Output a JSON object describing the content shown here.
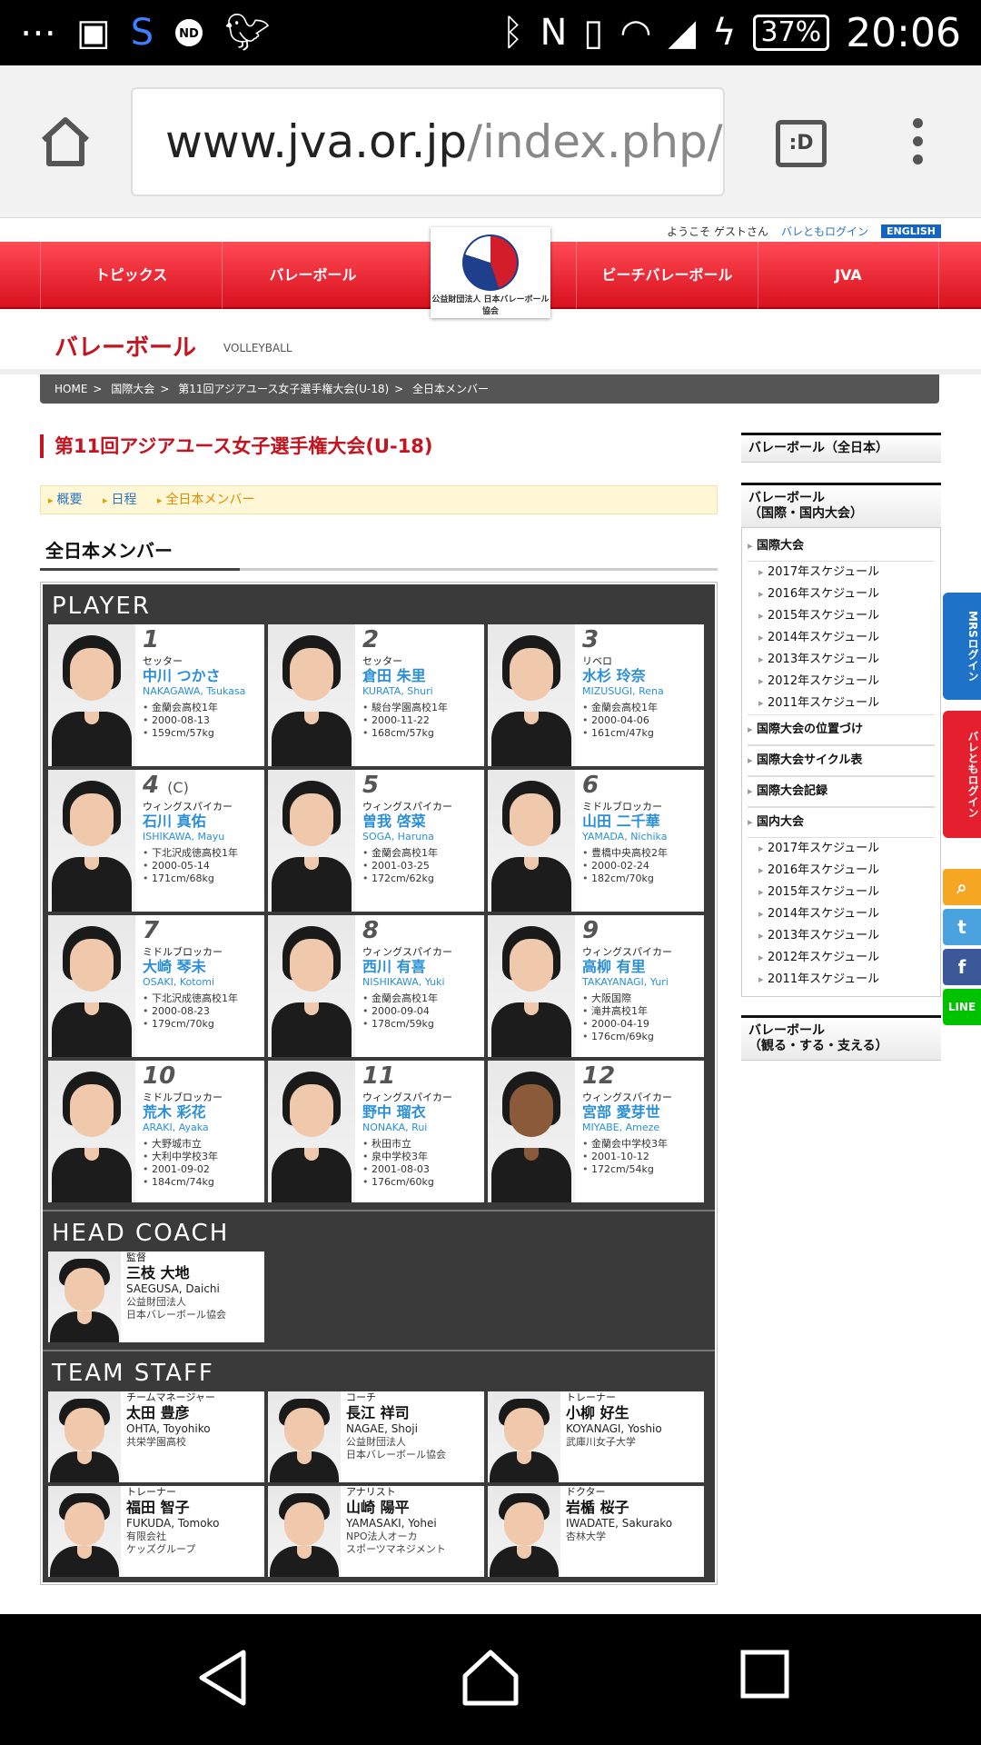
{
  "status": {
    "battery": "37%",
    "time": "20:06",
    "notif_badge": "ND"
  },
  "browser": {
    "url_host": "www.jva.or.jp",
    "url_path": "/index.php/",
    "tab_label": ":D"
  },
  "site": {
    "welcome": "ようこそ ゲストさん",
    "login_link": "バレともログイン",
    "english": "ENGLISH",
    "nav": [
      "トピックス",
      "バレーボール",
      "ビーチバレーボール",
      "JVA"
    ],
    "logo_text": "公益財団法人 日本バレーボール協会",
    "section_title": "バレーボール",
    "section_sub": "VOLLEYBALL"
  },
  "breadcrumb": [
    "HOME",
    "国際大会",
    "第11回アジアユース女子選手権大会(U-18)",
    "全日本メンバー"
  ],
  "event_title": "第11回アジアユース女子選手権大会(U-18)",
  "subnav": {
    "items": [
      "概要",
      "日程",
      "全日本メンバー"
    ]
  },
  "members_heading": "全日本メンバー",
  "groups": {
    "player": "PLAYER",
    "coach": "HEAD COACH",
    "staff": "TEAM STAFF"
  },
  "players": [
    {
      "num": "1",
      "cap": "",
      "pos": "セッター",
      "jp": "中川 つかさ",
      "en": "NAKAGAWA, Tsukasa",
      "details": [
        "金蘭会高校1年",
        "2000-08-13",
        "159cm/57kg"
      ]
    },
    {
      "num": "2",
      "cap": "",
      "pos": "セッター",
      "jp": "倉田 朱里",
      "en": "KURATA, Shuri",
      "details": [
        "駿台学園高校1年",
        "2000-11-22",
        "168cm/57kg"
      ]
    },
    {
      "num": "3",
      "cap": "",
      "pos": "リベロ",
      "jp": "水杉 玲奈",
      "en": "MIZUSUGI, Rena",
      "details": [
        "金蘭会高校1年",
        "2000-04-06",
        "161cm/47kg"
      ]
    },
    {
      "num": "4",
      "cap": "(C)",
      "pos": "ウィングスパイカー",
      "jp": "石川 真佑",
      "en": "ISHIKAWA, Mayu",
      "details": [
        "下北沢成徳高校1年",
        "2000-05-14",
        "171cm/68kg"
      ]
    },
    {
      "num": "5",
      "cap": "",
      "pos": "ウィングスパイカー",
      "jp": "曽我 啓菜",
      "en": "SOGA, Haruna",
      "details": [
        "金蘭会高校1年",
        "2001-03-25",
        "172cm/62kg"
      ]
    },
    {
      "num": "6",
      "cap": "",
      "pos": "ミドルブロッカー",
      "jp": "山田 二千華",
      "en": "YAMADA, Nichika",
      "details": [
        "豊橋中央高校2年",
        "2000-02-24",
        "182cm/70kg"
      ]
    },
    {
      "num": "7",
      "cap": "",
      "pos": "ミドルブロッカー",
      "jp": "大崎 琴未",
      "en": "OSAKI, Kotomi",
      "details": [
        "下北沢成徳高校1年",
        "2000-08-23",
        "179cm/70kg"
      ]
    },
    {
      "num": "8",
      "cap": "",
      "pos": "ウィングスパイカー",
      "jp": "西川 有喜",
      "en": "NISHIKAWA, Yuki",
      "details": [
        "金蘭会高校1年",
        "2000-09-04",
        "178cm/59kg"
      ]
    },
    {
      "num": "9",
      "cap": "",
      "pos": "ウィングスパイカー",
      "jp": "高柳 有里",
      "en": "TAKAYANAGI, Yuri",
      "details": [
        "大阪国際",
        "滝井高校1年",
        "2000-04-19",
        "176cm/69kg"
      ]
    },
    {
      "num": "10",
      "cap": "",
      "pos": "ミドルブロッカー",
      "jp": "荒木 彩花",
      "en": "ARAKI, Ayaka",
      "details": [
        "大野城市立",
        "大利中学校3年",
        "2001-09-02",
        "184cm/74kg"
      ]
    },
    {
      "num": "11",
      "cap": "",
      "pos": "ウィングスパイカー",
      "jp": "野中 瑠衣",
      "en": "NONAKA, Rui",
      "details": [
        "秋田市立",
        "泉中学校3年",
        "2001-08-03",
        "176cm/60kg"
      ]
    },
    {
      "num": "12",
      "cap": "",
      "pos": "ウィングスパイカー",
      "jp": "宮部 愛芽世",
      "en": "MIYABE, Ameze",
      "details": [
        "金蘭会中学校3年",
        "2001-10-12",
        "172cm/54kg"
      ]
    }
  ],
  "coach": {
    "role": "監督",
    "jp": "三枝 大地",
    "en": "SAEGUSA, Daichi",
    "aff1": "公益財団法人",
    "aff2": "日本バレーボール協会"
  },
  "staff": [
    {
      "role": "チームマネージャー",
      "jp": "太田 豊彦",
      "en": "OHTA, Toyohiko",
      "aff1": "共栄学園高校",
      "aff2": ""
    },
    {
      "role": "コーチ",
      "jp": "長江 祥司",
      "en": "NAGAE, Shoji",
      "aff1": "公益財団法人",
      "aff2": "日本バレーボール協会"
    },
    {
      "role": "トレーナー",
      "jp": "小柳 好生",
      "en": "KOYANAGI, Yoshio",
      "aff1": "武庫川女子大学",
      "aff2": ""
    },
    {
      "role": "トレーナー",
      "jp": "福田 智子",
      "en": "FUKUDA, Tomoko",
      "aff1": "有限会社",
      "aff2": "ケッズグループ"
    },
    {
      "role": "アナリスト",
      "jp": "山崎 陽平",
      "en": "YAMASAKI, Yohei",
      "aff1": "NPO法人オーカ",
      "aff2": "スポーツマネジメント"
    },
    {
      "role": "ドクター",
      "jp": "岩楯 桜子",
      "en": "IWADATE, Sakurako",
      "aff1": "杏林大学",
      "aff2": ""
    }
  ],
  "sidebar": {
    "box1": "バレーボール（全日本）",
    "box2_l1": "バレーボール",
    "box2_l2": "（国際・国内大会）",
    "intl": "国際大会",
    "intl_items": [
      "2017年スケジュール",
      "2016年スケジュール",
      "2015年スケジュール",
      "2014年スケジュール",
      "2013年スケジュール",
      "2012年スケジュール",
      "2011年スケジュール"
    ],
    "links": [
      "国際大会の位置づけ",
      "国際大会サイクル表",
      "国際大会記録"
    ],
    "domestic": "国内大会",
    "dom_items": [
      "2017年スケジュール",
      "2016年スケジュール",
      "2015年スケジュール",
      "2014年スケジュール",
      "2013年スケジュール",
      "2012年スケジュール",
      "2011年スケジュール"
    ],
    "box3_l1": "バレーボール",
    "box3_l2": "（観る・する・支える）"
  },
  "side_tabs": {
    "mrs": "MRSログイン",
    "valetomo": "バレともログイン"
  },
  "colors": {
    "brand_red": "#d8111e",
    "link_blue": "#2a8fd6",
    "roster_bg": "#3a3a3a"
  }
}
